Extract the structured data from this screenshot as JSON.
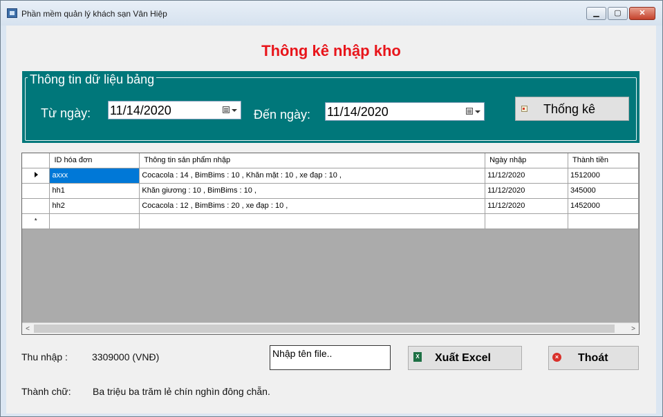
{
  "window": {
    "title": "Phần mềm quản lý khách sạn Vân Hiệp",
    "min_label": "▁",
    "max_label": "▢",
    "close_label": "✕"
  },
  "heading": "Thông kê nhập kho",
  "filter": {
    "group_title": "Thông tin dữ liệu  bảng",
    "from_label": "Từ ngày:",
    "from_value": "11/14/2020",
    "to_label": "Đến ngày:",
    "to_value": "11/14/2020",
    "stat_button": "Thống kê"
  },
  "grid": {
    "columns": [
      "ID hóa đơn",
      "Thông tin sản phẩm nhập",
      "Ngày nhập",
      "Thành tiền"
    ],
    "rows": [
      {
        "id": "axxx",
        "info": "Cocacola : 14    ,  BimBims : 10    ,  Khăn mặt : 10    ,  xe đạp : 10    ,",
        "date": "11/12/2020",
        "total": "1512000"
      },
      {
        "id": "hh1",
        "info": "Khăn giương : 10    ,  BimBims : 10    ,",
        "date": "11/12/2020",
        "total": "345000"
      },
      {
        "id": "hh2",
        "info": "Cocacola : 12    ,  BimBims : 20    ,  xe đạp : 10    ,",
        "date": "11/12/2020",
        "total": "1452000"
      }
    ],
    "new_row_marker": "*",
    "scroll_left": "<",
    "scroll_right": ">"
  },
  "summary": {
    "income_label": "Thu nhập :",
    "income_value": "3309000 (VNĐ)",
    "words_label": "Thành chữ:",
    "words_value": "Ba triệu ba trăm lẻ chín nghìn đông chẵn."
  },
  "file_input": {
    "value": "Nhập tên file.."
  },
  "buttons": {
    "export": "Xuất Excel",
    "export_icon_text": "X",
    "exit": "Thoát",
    "exit_icon_text": "×"
  }
}
